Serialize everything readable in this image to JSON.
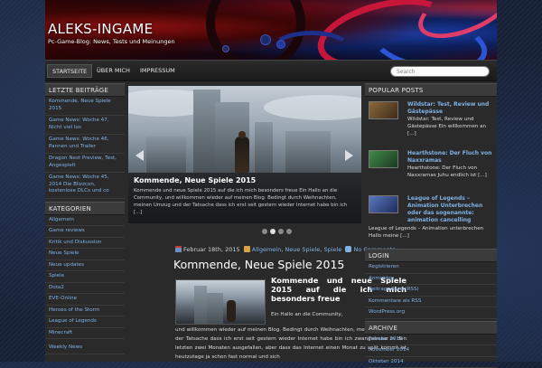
{
  "site": {
    "title": "ALEKS-INGAME",
    "description": "Pc-Game-Blog: News, Tests und Meinungen"
  },
  "nav": {
    "items": [
      {
        "label": "STARTSEITE"
      },
      {
        "label": "ÜBER MICH"
      },
      {
        "label": "IMPRESSUM"
      }
    ],
    "search_placeholder": "Search"
  },
  "left_sidebar": {
    "recent_title": "LETZTE BEITRÄGE",
    "recent": [
      "Kommende, Neue Spiele 2015",
      "Game News: Woche 47, Nicht viel los",
      "Game News: Woche 46, Pannen und Trailer",
      "Dragon Nest Preview, Test, Angespielt",
      "Game News: Woche 45, 2014 Die Blizzcon, kostenlose DLCs und co"
    ],
    "categories_title": "KATEGORIEN",
    "categories": [
      "Allgemein",
      "Game reviews",
      "Kritik und Diskussion",
      "Neue Spiele",
      "Neue updates",
      "Spiele",
      "Dota2",
      "EVE-Online",
      "Heroes of the Storm",
      "League of Legends",
      "Minecraft",
      "Weekly News"
    ]
  },
  "slider": {
    "title": "Kommende, Neue Spiele 2015",
    "text": "Kommende und neue Spiele 2015 auf die ich mich besonders freue Ein Hallo an die Community, und willkommen wieder auf meinen Blog. Bedingt durch Weihnachten, meinen Umzug und der Tatsache dass ich erst seit gestern wieder Internet habe bin ich [...]",
    "dots": 4,
    "active_dot": 1
  },
  "post": {
    "date": "Februar 18th, 2015",
    "categories": [
      "Allgemein",
      "Neue Spiele",
      "Spiele"
    ],
    "comments": "No Comments »",
    "title": "Kommende, Neue Spiele 2015",
    "subtitle": "Kommende und neue Spiele 2015 auf die ich mich besonders freue",
    "hello": "Ein Hallo an die Community,",
    "body": "und willkommen wieder auf meinen Blog. Bedingt durch Weihnachten, meinen Umzug und der Tatsache dass ich erst seit gestern wieder Internet habe bin ich zwangsweise in den letzten zwei Monaten ausgefallen, aber dass das Internet einen Monat zu spät kommt ist heutzutage ja schon fast normal und sich"
  },
  "popular": {
    "title": "POPULAR POSTS",
    "items": [
      {
        "title": "Wildstar: Test, Review und Gästepässe",
        "excerpt": "Wildstar: Test, Review und Gästepässe Ein willkommen an [...]",
        "thumb_color": "#6b4a2a"
      },
      {
        "title": "Hearthstone: Der Fluch von Naxxramas",
        "excerpt": "Hearthstone: Der Fluch von Naxxramas Juhu endlich ist [...]",
        "thumb_color": "#2e6a3a"
      },
      {
        "title": "League of Legends – Animation Unterbrechen oder das sogenannte: animation cancelling",
        "excerpt": "League of Legends – Animation unterbrechen Hallo meine [...]",
        "thumb_color": "#3a4f8a"
      }
    ]
  },
  "login": {
    "title": "LOGIN",
    "links": [
      "Registrieren",
      "Anmelden",
      "Beitrags-Feed (RSS)",
      "Kommentare als RSS",
      "WordPress.org"
    ]
  },
  "archive": {
    "title": "ARCHIVE",
    "items": [
      "Februar 2015",
      "November 2014",
      "Oktober 2014"
    ]
  },
  "colors": {
    "link": "#7fb2e6",
    "widget_bar": "#3b3b3b",
    "content_bg": "#2a2a2a"
  }
}
